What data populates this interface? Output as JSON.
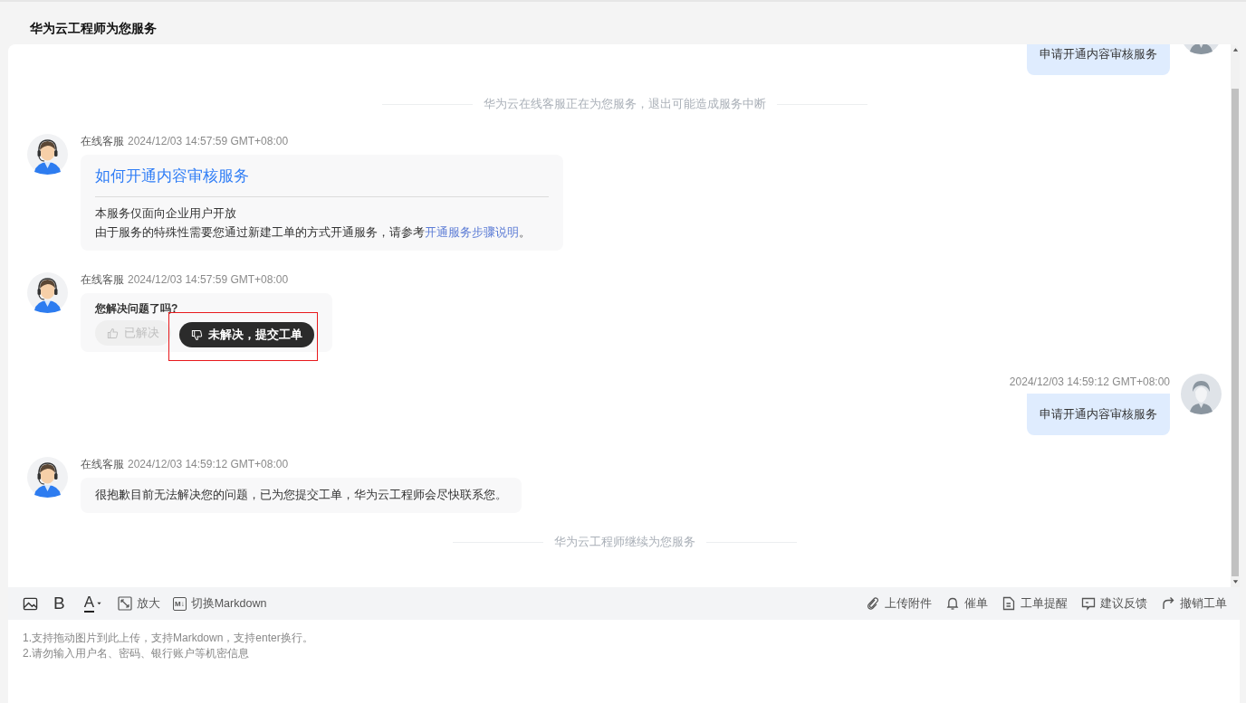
{
  "title": "华为云工程师为您服务",
  "messages": [
    {
      "kind": "user",
      "text": "申请开通内容审核服务"
    },
    {
      "kind": "notice",
      "text": "华为云在线客服正在为您服务，退出可能造成服务中断"
    },
    {
      "kind": "article",
      "sender": "在线客服",
      "time": "2024/12/03 14:57:59 GMT+08:00",
      "heading": "如何开通内容审核服务",
      "lines": [
        "本服务仅面向企业用户开放"
      ],
      "paragraph": "由于服务的特殊性需要您通过新建工单的方式开通服务，请参考",
      "link": "开通服务步骤说明",
      "suffix": "。"
    },
    {
      "kind": "feedback",
      "sender": "在线客服",
      "time": "2024/12/03 14:57:59 GMT+08:00",
      "question": "您解决问题了吗?",
      "options": [
        {
          "label": "已解决",
          "selected": false,
          "highlighted": false
        },
        {
          "label": "未解决，提交工单",
          "selected": true,
          "highlighted": true
        }
      ]
    },
    {
      "kind": "user",
      "time": "2024/12/03 14:59:12 GMT+08:00",
      "text": "申请开通内容审核服务"
    },
    {
      "kind": "text",
      "sender": "在线客服",
      "time": "2024/12/03 14:59:12 GMT+08:00",
      "text": "很抱歉目前无法解决您的问题，已为您提交工单，华为云工程师会尽快联系您。"
    },
    {
      "kind": "notice",
      "text": "华为云工程师继续为您服务"
    }
  ],
  "toolbar": {
    "left": [
      {
        "kind": "image"
      },
      {
        "kind": "glyph",
        "glyph": "B"
      },
      {
        "kind": "color",
        "glyph": "A"
      },
      {
        "kind": "labeled",
        "label": "放大"
      },
      {
        "kind": "labeled",
        "icon_text": "M↓",
        "label": "切换Markdown"
      }
    ],
    "right": [
      {
        "label": "上传附件"
      },
      {
        "label": "催单"
      },
      {
        "label": "工单提醒"
      },
      {
        "label": "建议反馈"
      },
      {
        "label": "撤销工单"
      }
    ]
  },
  "input": {
    "placeholder": "1.支持拖动图片到此上传，支持Markdown，支持enter换行。\n2.请勿输入用户名、密码、银行账户等机密信息"
  }
}
